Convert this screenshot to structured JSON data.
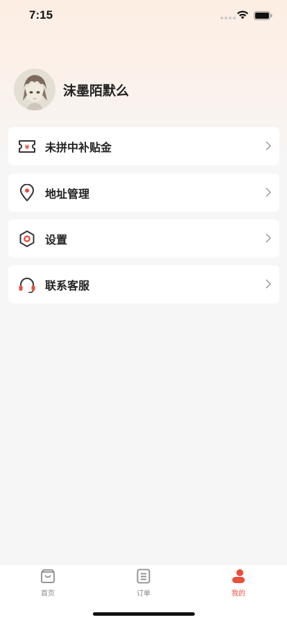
{
  "status_bar": {
    "time": "7:15"
  },
  "profile": {
    "username": "沫墨陌默么"
  },
  "menu": [
    {
      "label": "未拼中补贴金",
      "icon": "coupon-ticket-icon"
    },
    {
      "label": "地址管理",
      "icon": "location-pin-icon"
    },
    {
      "label": "设置",
      "icon": "settings-hexagon-icon"
    },
    {
      "label": "联系客服",
      "icon": "headset-icon"
    }
  ],
  "tab_bar": {
    "tabs": [
      {
        "label": "首页",
        "icon": "shopping-bag-icon",
        "active": false
      },
      {
        "label": "订单",
        "icon": "order-list-icon",
        "active": false
      },
      {
        "label": "我的",
        "icon": "profile-icon",
        "active": true
      }
    ]
  },
  "colors": {
    "accent": "#ea4e3d",
    "icon_dark": "#333333",
    "inactive": "#888888",
    "page_bg": "#f6f6f6"
  }
}
